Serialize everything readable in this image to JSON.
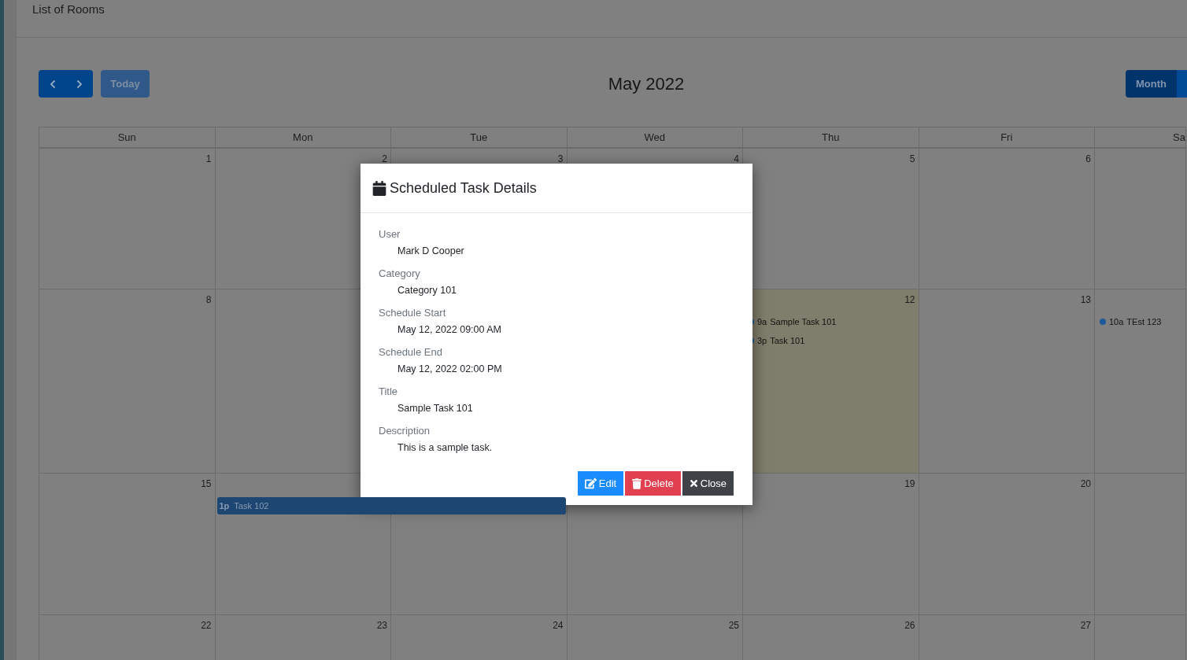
{
  "page": {
    "title": "List of Rooms"
  },
  "toolbar": {
    "today": {
      "label": "Today",
      "disabled": true
    },
    "month_title": "May 2022",
    "views": [
      {
        "label": "Month",
        "selected": true
      },
      {
        "selected": false
      }
    ]
  },
  "calendar": {
    "weekdays": [
      "Sun",
      "Mon",
      "Tue",
      "Wed",
      "Thu",
      "Fri",
      "Sa"
    ],
    "weeks": [
      {
        "cells": [
          {
            "day": "1",
            "today": false
          },
          {
            "day": "2",
            "today": false
          },
          {
            "day": "3",
            "today": false
          },
          {
            "day": "4",
            "today": false
          },
          {
            "day": "5",
            "today": false
          },
          {
            "day": "6",
            "today": false
          },
          {
            "today": false
          }
        ]
      },
      {
        "cells": [
          {
            "day": "8",
            "today": false
          },
          {
            "today": false
          },
          {},
          {},
          {
            "day": "12",
            "today": true,
            "events": [
              {
                "kind": "dot",
                "time": "9a",
                "title": "Sample Task 101"
              },
              {
                "kind": "dot",
                "time": "3p",
                "title": "Task 101"
              }
            ]
          },
          {
            "day": "13",
            "today": false
          },
          {
            "today": false,
            "events": [
              {
                "kind": "dot",
                "time": "10a",
                "title": "TEst 123"
              }
            ]
          }
        ]
      },
      {
        "cells": [
          {
            "day": "15",
            "today": false
          },
          {
            "today": false,
            "events": [
              {
                "kind": "bar",
                "time": "1p",
                "title": "Task 102",
                "spans_next_day": true
              }
            ]
          },
          {
            "today": false
          },
          {
            "today": false
          },
          {
            "day": "19",
            "today": false
          },
          {
            "day": "20",
            "today": false
          },
          {
            "today": false
          }
        ]
      },
      {
        "cells": [
          {
            "day": "22",
            "today": false
          },
          {
            "day": "23",
            "today": false
          },
          {
            "day": "24",
            "today": false
          },
          {
            "day": "25",
            "today": false
          },
          {
            "day": "26",
            "today": false
          },
          {
            "day": "27",
            "today": false
          },
          {
            "today": false
          }
        ]
      }
    ]
  },
  "modal": {
    "title": "Scheduled Task Details",
    "fields": [
      {
        "label": "User",
        "value": "Mark D Cooper"
      },
      {
        "label": "Category",
        "value": "Category 101"
      },
      {
        "label": "Schedule Start",
        "value": "May 12, 2022 09:00 AM"
      },
      {
        "label": "Schedule End",
        "value": "May 12, 2022 02:00 PM"
      },
      {
        "label": "Title",
        "value": "Sample Task 101"
      },
      {
        "label": "Description",
        "value": "This is a sample task."
      }
    ],
    "buttons": [
      {
        "kind": "edit",
        "label": "Edit"
      },
      {
        "kind": "delete",
        "label": "Delete"
      },
      {
        "kind": "close",
        "label": "Close"
      }
    ]
  }
}
